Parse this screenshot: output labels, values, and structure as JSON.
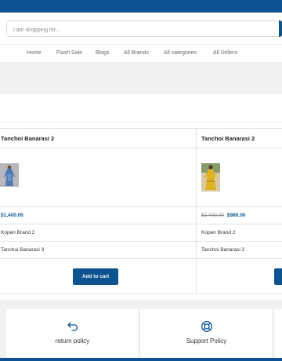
{
  "search": {
    "placeholder": "I am shopping for..."
  },
  "nav": {
    "items": [
      {
        "label": "Home"
      },
      {
        "label": "Flash Sale"
      },
      {
        "label": "Blogs"
      },
      {
        "label": "All Brands"
      },
      {
        "label": "All categories"
      },
      {
        "label": "All Sellers"
      }
    ]
  },
  "products": [
    {
      "name": "Tanchoi Banarasi 2",
      "image_icon": "product-photo-blue-dress",
      "old_price": "",
      "price": "$1,400.00",
      "brand": "Kopen Brand 2",
      "model": "Tanchoi Banarasi 3",
      "button_label": "Add to cart"
    },
    {
      "name": "Tanchoi Banarasi 2",
      "image_icon": "product-photo-yellow-dress",
      "old_price": "$1,400.00",
      "price": "$980.00",
      "brand": "Kopen Brand 2",
      "model": "Tanchoi Banarasi 2",
      "button_label": ""
    }
  ],
  "policies": [
    {
      "label": "return policy",
      "icon": "return-arrow-icon"
    },
    {
      "label": "Support Policy",
      "icon": "lifebuoy-icon"
    }
  ],
  "colors": {
    "brand": "#0d5390",
    "price": "#0d5390",
    "band": "#f1f1f3"
  }
}
